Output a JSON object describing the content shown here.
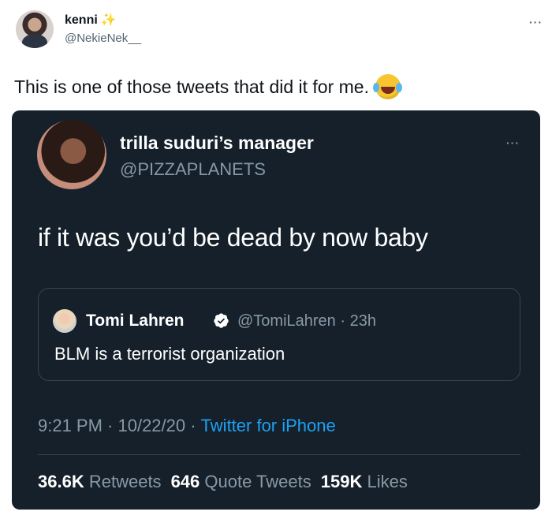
{
  "outer_tweet": {
    "name": "kenni",
    "handle": "@NekieNek__",
    "text": "This is one of those tweets that did it for me.",
    "more": "···"
  },
  "card": {
    "name": "trilla suduri’s manager",
    "handle": "@PIZZAPLANETS",
    "more": "···",
    "text": "if it was you’d be dead by now baby",
    "quote": {
      "name": "Tomi Lahren",
      "handle_time": "@TomiLahren · 23h",
      "text": "BLM is a terrorist organization"
    },
    "meta": {
      "time_date": "9:21 PM · 10/22/20 ·",
      "source": "Twitter for iPhone"
    },
    "stats": [
      {
        "value": "36.6K",
        "label": "Retweets"
      },
      {
        "value": "646",
        "label": "Quote Tweets"
      },
      {
        "value": "159K",
        "label": "Likes"
      }
    ]
  },
  "colors": {
    "card_bg": "#15202b",
    "secondary_text": "#8899a6",
    "link_blue": "#1da1f2",
    "border": "#38444d"
  }
}
